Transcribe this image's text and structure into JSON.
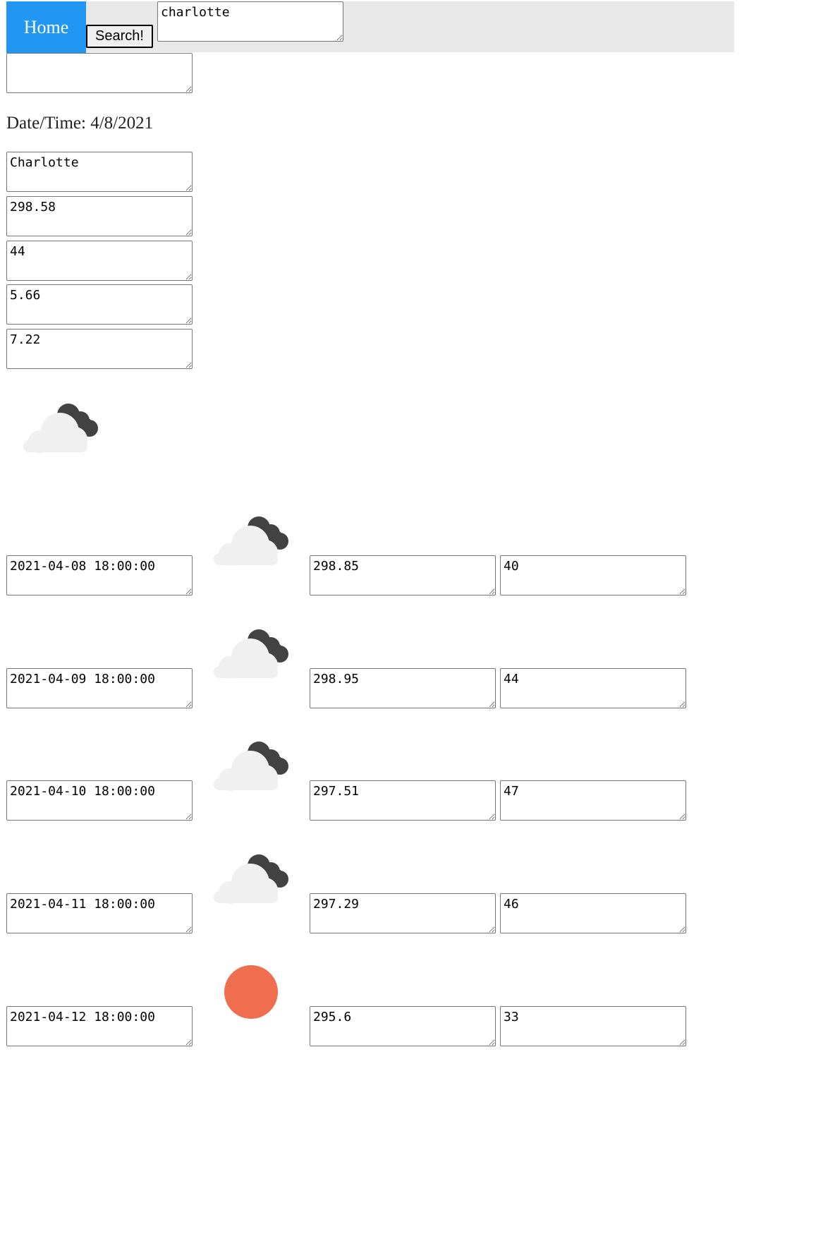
{
  "nav": {
    "home_label": "Home",
    "search_label": "Search!",
    "search_value": "charlotte"
  },
  "extra_input_value": "",
  "current": {
    "datetime_label": "Date/Time: 4/8/2021",
    "city": "Charlotte",
    "temp": "298.58",
    "humidity": "44",
    "wind": "5.66",
    "uv": "7.22",
    "icon": "cloudy-night-icon"
  },
  "forecast": [
    {
      "datetime": "2021-04-08 18:00:00",
      "icon": "cloudy-night-icon",
      "temp": "298.85",
      "humidity": "40"
    },
    {
      "datetime": "2021-04-09 18:00:00",
      "icon": "cloudy-night-icon",
      "temp": "298.95",
      "humidity": "44"
    },
    {
      "datetime": "2021-04-10 18:00:00",
      "icon": "cloudy-night-icon",
      "temp": "297.51",
      "humidity": "47"
    },
    {
      "datetime": "2021-04-11 18:00:00",
      "icon": "cloudy-night-icon",
      "temp": "297.29",
      "humidity": "46"
    },
    {
      "datetime": "2021-04-12 18:00:00",
      "icon": "sun-icon",
      "temp": "295.6",
      "humidity": "33"
    }
  ],
  "colors": {
    "home_bg": "#2196f3",
    "topbar_bg": "#e8e8e8",
    "cloud_light": "#eeeeee",
    "cloud_dark": "#424242",
    "sun": "#ee6e4e"
  }
}
